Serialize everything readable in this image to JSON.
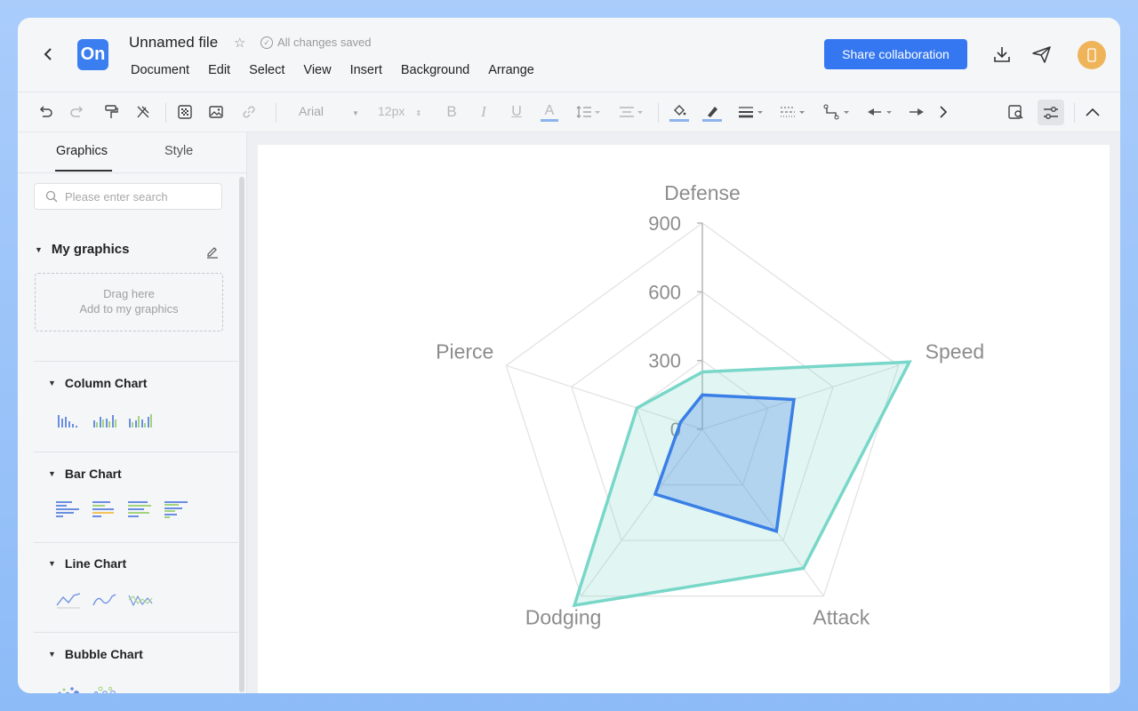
{
  "header": {
    "file_title": "Unnamed file",
    "saved_status": "All changes saved",
    "logo_text": "On",
    "menu": [
      "Document",
      "Edit",
      "Select",
      "View",
      "Insert",
      "Background",
      "Arrange"
    ],
    "share_label": "Share collaboration",
    "avatar_text": ""
  },
  "toolbar": {
    "font_name": "Arial",
    "font_size": "12px"
  },
  "left_panel": {
    "tabs": [
      "Graphics",
      "Style"
    ],
    "search_placeholder": "Please enter search",
    "my_graphics_label": "My graphics",
    "dropzone_line1": "Drag here",
    "dropzone_line2": "Add to my graphics",
    "categories": [
      "Column Chart",
      "Bar Chart",
      "Line Chart",
      "Bubble Chart"
    ]
  },
  "chart_data": {
    "type": "radar",
    "indicators": [
      "Defense",
      "Speed",
      "Attack",
      "Dodging",
      "Pierce"
    ],
    "radial_ticks": [
      "900",
      "600",
      "300",
      "0"
    ],
    "max": 900,
    "series": [
      {
        "values": [
          250,
          950,
          750,
          950,
          300
        ],
        "color": "#78d7c8"
      },
      {
        "values": [
          150,
          420,
          550,
          350,
          100
        ],
        "color": "#3a7fe6"
      }
    ]
  },
  "colors": {
    "accent": "#3577f0",
    "avatar": "#efb45a"
  }
}
